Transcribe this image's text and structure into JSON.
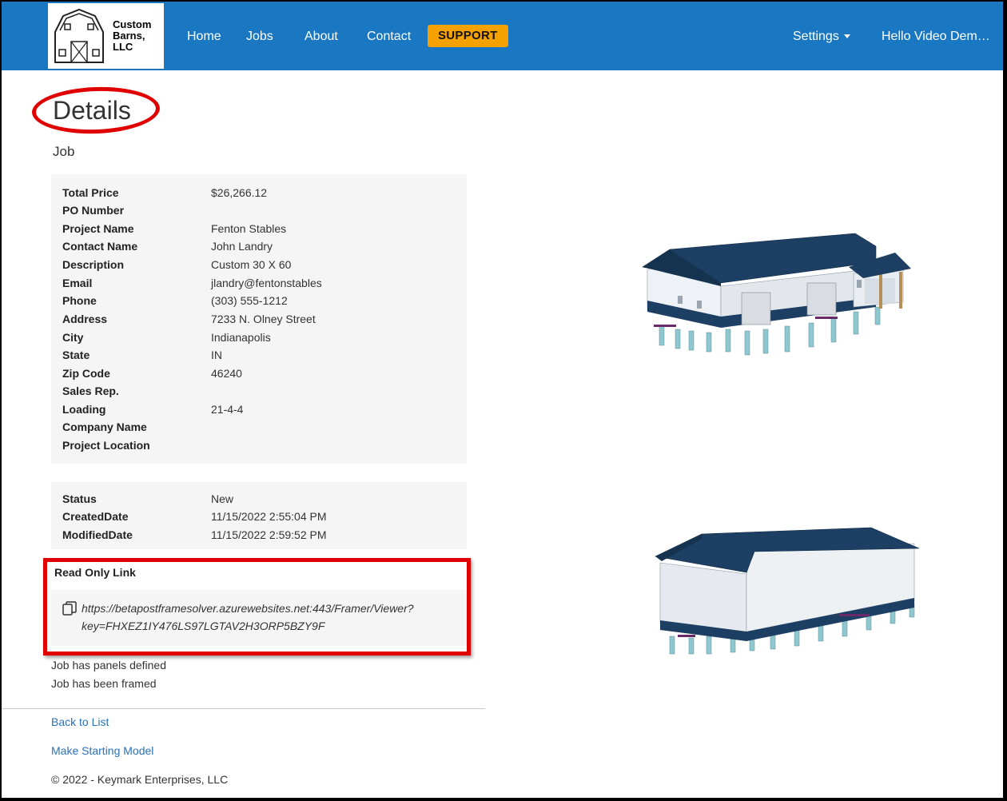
{
  "navbar": {
    "brand_lines": [
      "Custom",
      "Barns,",
      "LLC"
    ],
    "links": [
      "Home",
      "Jobs",
      "About",
      "Contact"
    ],
    "support_label": "SUPPORT",
    "settings_label": "Settings",
    "user_label": "Hello Video Dem…"
  },
  "page": {
    "title": "Details",
    "subtitle": "Job"
  },
  "job_fields": [
    {
      "label": "Total Price",
      "value": "$26,266.12"
    },
    {
      "label": "PO Number",
      "value": ""
    },
    {
      "label": "Project Name",
      "value": "Fenton Stables"
    },
    {
      "label": "Contact Name",
      "value": "John Landry"
    },
    {
      "label": "Description",
      "value": "Custom 30 X 60"
    },
    {
      "label": "Email",
      "value": "jlandry@fentonstables"
    },
    {
      "label": "Phone",
      "value": "(303) 555-1212"
    },
    {
      "label": "Address",
      "value": "7233 N. Olney Street"
    },
    {
      "label": "City",
      "value": "Indianapolis"
    },
    {
      "label": "State",
      "value": "IN"
    },
    {
      "label": "Zip Code",
      "value": "46240"
    },
    {
      "label": "Sales Rep.",
      "value": ""
    },
    {
      "label": "Loading",
      "value": "21-4-4"
    },
    {
      "label": "Company Name",
      "value": ""
    },
    {
      "label": "Project Location",
      "value": ""
    }
  ],
  "status_fields": [
    {
      "label": "Status",
      "value": "New"
    },
    {
      "label": "CreatedDate",
      "value": "11/15/2022 2:55:04 PM"
    },
    {
      "label": "ModifiedDate",
      "value": "11/15/2022 2:59:52 PM"
    }
  ],
  "read_only": {
    "title": "Read Only Link",
    "line1": "https://betapostframesolver.azurewebsites.net:443/Framer/Viewer?",
    "line2": "key=FHXEZ1IY476LS97LGTAV2H3ORP5BZY9F"
  },
  "notes": [
    "Job has panels defined",
    "Job has been framed"
  ],
  "footer": {
    "back_link": "Back to List",
    "model_link": "Make Starting Model",
    "copyright": "© 2022 - Keymark Enterprises, LLC"
  },
  "colors": {
    "navbar": "#1a78c2",
    "support": "#f5a200",
    "highlight": "#e00000",
    "roof": "#1d3f63"
  }
}
